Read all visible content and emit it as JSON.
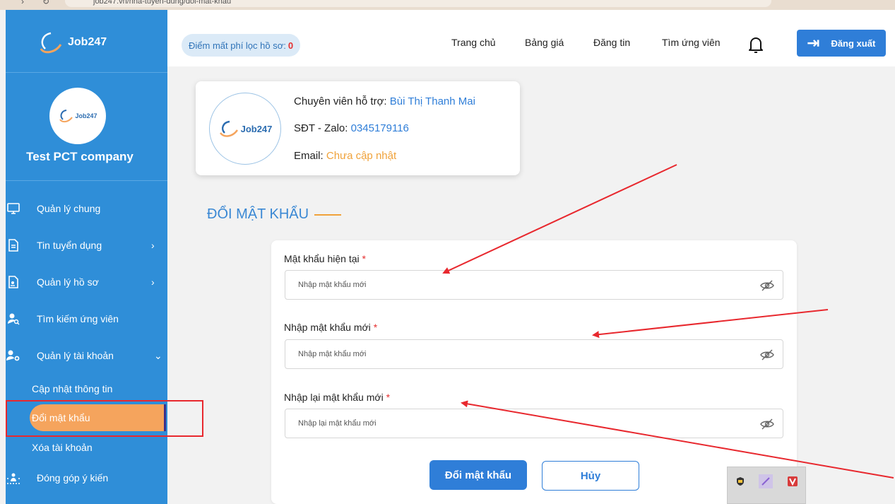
{
  "browser": {
    "url": "job247.vn/nha-tuyen-dung/doi-mat-khau"
  },
  "sidebar": {
    "logo": "Job247",
    "avatar_logo": "Job247",
    "company": "Test PCT company",
    "items": [
      {
        "label": "Quản lý chung",
        "icon": "monitor-icon"
      },
      {
        "label": "Tin tuyển dụng",
        "icon": "document-icon"
      },
      {
        "label": "Quản lý hồ sơ",
        "icon": "resume-icon"
      },
      {
        "label": "Tìm kiếm ứng viên",
        "icon": "user-search-icon"
      },
      {
        "label": "Quản lý tài khoản",
        "icon": "user-gear-icon"
      },
      {
        "label": "Đóng góp ý kiến",
        "icon": "feedback-icon"
      }
    ],
    "sub_items": [
      "Cập nhật thông tin",
      "Đổi mật khẩu",
      "Xóa tài khoản"
    ]
  },
  "header": {
    "points_label": "Điểm mất phí lọc hồ sơ:",
    "points_value": "0",
    "nav": [
      "Trang chủ",
      "Bảng giá",
      "Đăng tin",
      "Tìm ứng viên"
    ],
    "logout": "Đăng xuất"
  },
  "support": {
    "logo": "Job247",
    "specialist_label": "Chuyên viên hỗ trợ:",
    "specialist_name": "Bùi Thị Thanh Mai",
    "phone_label": "SĐT - Zalo:",
    "phone": "0345179116",
    "email_label": "Email:",
    "email": "Chưa cập nhật"
  },
  "page_title": "ĐỔI MẬT KHẨU",
  "form": {
    "fields": [
      {
        "label": "Mật khẩu hiện tại",
        "placeholder": "Nhập mật khẩu mới"
      },
      {
        "label": "Nhập mật khẩu mới",
        "placeholder": "Nhập mật khẩu mới"
      },
      {
        "label": "Nhập lại mật khẩu mới",
        "placeholder": "Nhập lại mật khẩu mới"
      }
    ],
    "required_mark": "*",
    "submit": "Đổi mật khẩu",
    "cancel": "Hủy"
  },
  "colors": {
    "sidebar": "#2f8ed8",
    "accent": "#f5a45d",
    "primary": "#2f7ed8",
    "annotation": "#e8282e"
  }
}
